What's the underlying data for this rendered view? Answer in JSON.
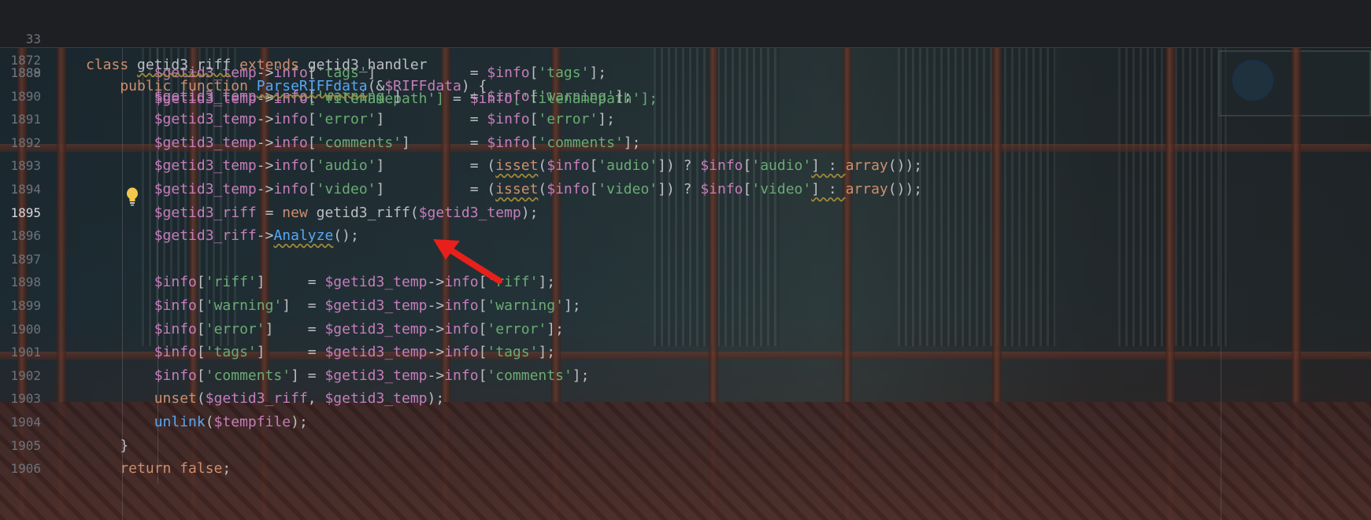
{
  "sticky": {
    "line1_no": "33",
    "line1": [
      {
        "t": "class ",
        "c": "kw"
      },
      {
        "t": "getid3_riff",
        "c": "plain warn"
      },
      {
        "t": " extends ",
        "c": "kw"
      },
      {
        "t": "getid3_handler",
        "c": "plain"
      }
    ],
    "line2_no": "1872",
    "line2": [
      {
        "t": "    public function ",
        "c": "kw"
      },
      {
        "t": "ParseRIFFdata",
        "c": "fn warn"
      },
      {
        "t": "(&",
        "c": "punct"
      },
      {
        "t": "$RIFFdata",
        "c": "var"
      },
      {
        "t": ") {",
        "c": "punct"
      }
    ]
  },
  "partial_line": {
    "no": "1888",
    "tokens": [
      {
        "t": "        $getid3_temp",
        "c": "var"
      },
      {
        "t": "->",
        "c": "punct"
      },
      {
        "t": "info",
        "c": "var"
      },
      {
        "t": "['filenamepath']",
        "c": "str"
      },
      {
        "t": " = ",
        "c": "punct"
      },
      {
        "t": "$info",
        "c": "var"
      },
      {
        "t": "['filenamepath'];",
        "c": "str"
      }
    ]
  },
  "lines": [
    {
      "no": "1889",
      "tokens": [
        {
          "t": "        $getid3_temp",
          "c": "var"
        },
        {
          "t": "->",
          "c": "punct"
        },
        {
          "t": "info",
          "c": "var"
        },
        {
          "t": "[",
          "c": "punct"
        },
        {
          "t": "'tags'",
          "c": "str"
        },
        {
          "t": "]           = ",
          "c": "punct"
        },
        {
          "t": "$info",
          "c": "var"
        },
        {
          "t": "[",
          "c": "punct"
        },
        {
          "t": "'tags'",
          "c": "str"
        },
        {
          "t": "];",
          "c": "punct"
        }
      ]
    },
    {
      "no": "1890",
      "tokens": [
        {
          "t": "        $getid3_temp",
          "c": "var"
        },
        {
          "t": "->",
          "c": "punct"
        },
        {
          "t": "info",
          "c": "var"
        },
        {
          "t": "[",
          "c": "punct"
        },
        {
          "t": "'warning'",
          "c": "str"
        },
        {
          "t": "]        = ",
          "c": "punct"
        },
        {
          "t": "$info",
          "c": "var"
        },
        {
          "t": "[",
          "c": "punct"
        },
        {
          "t": "'warning'",
          "c": "str"
        },
        {
          "t": "];",
          "c": "punct"
        }
      ]
    },
    {
      "no": "1891",
      "tokens": [
        {
          "t": "        $getid3_temp",
          "c": "var"
        },
        {
          "t": "->",
          "c": "punct"
        },
        {
          "t": "info",
          "c": "var"
        },
        {
          "t": "[",
          "c": "punct"
        },
        {
          "t": "'error'",
          "c": "str"
        },
        {
          "t": "]          = ",
          "c": "punct"
        },
        {
          "t": "$info",
          "c": "var"
        },
        {
          "t": "[",
          "c": "punct"
        },
        {
          "t": "'error'",
          "c": "str"
        },
        {
          "t": "];",
          "c": "punct"
        }
      ]
    },
    {
      "no": "1892",
      "tokens": [
        {
          "t": "        $getid3_temp",
          "c": "var"
        },
        {
          "t": "->",
          "c": "punct"
        },
        {
          "t": "info",
          "c": "var"
        },
        {
          "t": "[",
          "c": "punct"
        },
        {
          "t": "'comments'",
          "c": "str"
        },
        {
          "t": "]       = ",
          "c": "punct"
        },
        {
          "t": "$info",
          "c": "var"
        },
        {
          "t": "[",
          "c": "punct"
        },
        {
          "t": "'comments'",
          "c": "str"
        },
        {
          "t": "];",
          "c": "punct"
        }
      ]
    },
    {
      "no": "1893",
      "tokens": [
        {
          "t": "        $getid3_temp",
          "c": "var"
        },
        {
          "t": "->",
          "c": "punct"
        },
        {
          "t": "info",
          "c": "var"
        },
        {
          "t": "[",
          "c": "punct"
        },
        {
          "t": "'audio'",
          "c": "str"
        },
        {
          "t": "]          = (",
          "c": "punct"
        },
        {
          "t": "isset",
          "c": "kw warn"
        },
        {
          "t": "(",
          "c": "punct"
        },
        {
          "t": "$info",
          "c": "var"
        },
        {
          "t": "[",
          "c": "punct"
        },
        {
          "t": "'audio'",
          "c": "str"
        },
        {
          "t": "]) ? ",
          "c": "punct"
        },
        {
          "t": "$info",
          "c": "var"
        },
        {
          "t": "[",
          "c": "punct"
        },
        {
          "t": "'audio'",
          "c": "str"
        },
        {
          "t": "] : ",
          "c": "punct warn"
        },
        {
          "t": "array",
          "c": "kw"
        },
        {
          "t": "());",
          "c": "punct"
        }
      ]
    },
    {
      "no": "1894",
      "tokens": [
        {
          "t": "        $getid3_temp",
          "c": "var"
        },
        {
          "t": "->",
          "c": "punct"
        },
        {
          "t": "info",
          "c": "var"
        },
        {
          "t": "[",
          "c": "punct"
        },
        {
          "t": "'video'",
          "c": "str"
        },
        {
          "t": "]          = (",
          "c": "punct"
        },
        {
          "t": "isset",
          "c": "kw warn"
        },
        {
          "t": "(",
          "c": "punct"
        },
        {
          "t": "$info",
          "c": "var"
        },
        {
          "t": "[",
          "c": "punct"
        },
        {
          "t": "'video'",
          "c": "str"
        },
        {
          "t": "]) ? ",
          "c": "punct"
        },
        {
          "t": "$info",
          "c": "var"
        },
        {
          "t": "[",
          "c": "punct"
        },
        {
          "t": "'video'",
          "c": "str"
        },
        {
          "t": "] : ",
          "c": "punct warn"
        },
        {
          "t": "array",
          "c": "kw"
        },
        {
          "t": "());",
          "c": "punct"
        }
      ]
    },
    {
      "no": "1895",
      "current": true,
      "tokens": [
        {
          "t": "        $getid3_riff",
          "c": "var"
        },
        {
          "t": " = ",
          "c": "punct"
        },
        {
          "t": "new ",
          "c": "kw"
        },
        {
          "t": "getid3_riff",
          "c": "plain"
        },
        {
          "t": "(",
          "c": "punct"
        },
        {
          "t": "$getid3_temp",
          "c": "var"
        },
        {
          "t": ");",
          "c": "punct"
        }
      ]
    },
    {
      "no": "1896",
      "tokens": [
        {
          "t": "        $getid3_riff",
          "c": "var"
        },
        {
          "t": "->",
          "c": "punct"
        },
        {
          "t": "Analyze",
          "c": "fn warn"
        },
        {
          "t": "();",
          "c": "punct"
        }
      ]
    },
    {
      "no": "1897",
      "tokens": []
    },
    {
      "no": "1898",
      "tokens": [
        {
          "t": "        $info",
          "c": "var"
        },
        {
          "t": "[",
          "c": "punct"
        },
        {
          "t": "'riff'",
          "c": "str"
        },
        {
          "t": "]     = ",
          "c": "punct"
        },
        {
          "t": "$getid3_temp",
          "c": "var"
        },
        {
          "t": "->",
          "c": "punct"
        },
        {
          "t": "info",
          "c": "var"
        },
        {
          "t": "[",
          "c": "punct"
        },
        {
          "t": "'riff'",
          "c": "str"
        },
        {
          "t": "];",
          "c": "punct"
        }
      ]
    },
    {
      "no": "1899",
      "tokens": [
        {
          "t": "        $info",
          "c": "var"
        },
        {
          "t": "[",
          "c": "punct"
        },
        {
          "t": "'warning'",
          "c": "str"
        },
        {
          "t": "]  = ",
          "c": "punct"
        },
        {
          "t": "$getid3_temp",
          "c": "var"
        },
        {
          "t": "->",
          "c": "punct"
        },
        {
          "t": "info",
          "c": "var"
        },
        {
          "t": "[",
          "c": "punct"
        },
        {
          "t": "'warning'",
          "c": "str"
        },
        {
          "t": "];",
          "c": "punct"
        }
      ]
    },
    {
      "no": "1900",
      "tokens": [
        {
          "t": "        $info",
          "c": "var"
        },
        {
          "t": "[",
          "c": "punct"
        },
        {
          "t": "'error'",
          "c": "str"
        },
        {
          "t": "]    = ",
          "c": "punct"
        },
        {
          "t": "$getid3_temp",
          "c": "var"
        },
        {
          "t": "->",
          "c": "punct"
        },
        {
          "t": "info",
          "c": "var"
        },
        {
          "t": "[",
          "c": "punct"
        },
        {
          "t": "'error'",
          "c": "str"
        },
        {
          "t": "];",
          "c": "punct"
        }
      ]
    },
    {
      "no": "1901",
      "tokens": [
        {
          "t": "        $info",
          "c": "var"
        },
        {
          "t": "[",
          "c": "punct"
        },
        {
          "t": "'tags'",
          "c": "str"
        },
        {
          "t": "]     = ",
          "c": "punct"
        },
        {
          "t": "$getid3_temp",
          "c": "var"
        },
        {
          "t": "->",
          "c": "punct"
        },
        {
          "t": "info",
          "c": "var"
        },
        {
          "t": "[",
          "c": "punct"
        },
        {
          "t": "'tags'",
          "c": "str"
        },
        {
          "t": "];",
          "c": "punct"
        }
      ]
    },
    {
      "no": "1902",
      "tokens": [
        {
          "t": "        $info",
          "c": "var"
        },
        {
          "t": "[",
          "c": "punct"
        },
        {
          "t": "'comments'",
          "c": "str"
        },
        {
          "t": "] = ",
          "c": "punct"
        },
        {
          "t": "$getid3_temp",
          "c": "var"
        },
        {
          "t": "->",
          "c": "punct"
        },
        {
          "t": "info",
          "c": "var"
        },
        {
          "t": "[",
          "c": "punct"
        },
        {
          "t": "'comments'",
          "c": "str"
        },
        {
          "t": "];",
          "c": "punct"
        }
      ]
    },
    {
      "no": "1903",
      "tokens": [
        {
          "t": "        unset",
          "c": "kw"
        },
        {
          "t": "(",
          "c": "punct"
        },
        {
          "t": "$getid3_riff",
          "c": "var"
        },
        {
          "t": ", ",
          "c": "punct"
        },
        {
          "t": "$getid3_temp",
          "c": "var"
        },
        {
          "t": ");",
          "c": "punct"
        }
      ]
    },
    {
      "no": "1904",
      "tokens": [
        {
          "t": "        unlink",
          "c": "fn"
        },
        {
          "t": "(",
          "c": "punct"
        },
        {
          "t": "$tempfile",
          "c": "var"
        },
        {
          "t": ");",
          "c": "punct"
        }
      ]
    },
    {
      "no": "1905",
      "tokens": [
        {
          "t": "    }",
          "c": "punct"
        }
      ]
    },
    {
      "no": "1906",
      "tokens": [
        {
          "t": "    return false",
          "c": "kw"
        },
        {
          "t": ";",
          "c": "punct"
        }
      ]
    }
  ],
  "colors": {
    "keyword": "#cf8e6d",
    "variable": "#c77dbb",
    "string": "#6aab73",
    "function": "#56a8f5",
    "text": "#bcbec4",
    "arrow": "#e8201c",
    "bulb": "#f2c94c"
  },
  "icons": {
    "gutter_hint": "lightbulb-icon",
    "annotation": "red-arrow-icon"
  }
}
